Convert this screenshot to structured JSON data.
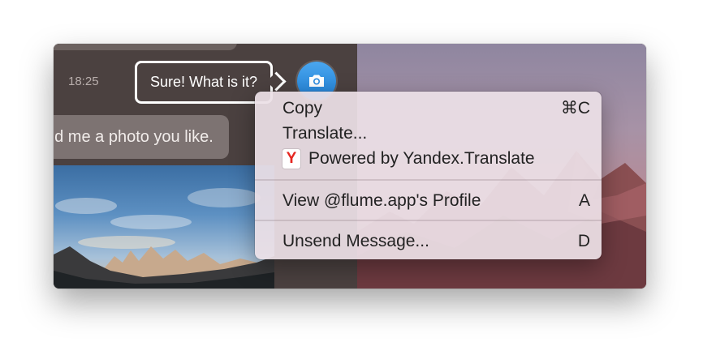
{
  "chat": {
    "timestamp": "18:25",
    "my_message": "Sure! What is it?",
    "their_message": "nd me a photo you like."
  },
  "context_menu": {
    "copy": {
      "label": "Copy",
      "shortcut": "⌘C"
    },
    "translate": {
      "label": "Translate..."
    },
    "powered_by": {
      "label": "Powered by Yandex.Translate",
      "icon_glyph": "Y"
    },
    "view_profile": {
      "label": "View @flume.app's Profile",
      "shortcut": "A"
    },
    "unsend": {
      "label": "Unsend Message...",
      "shortcut": "D"
    }
  },
  "colors": {
    "accent": "#2a8be0",
    "yandex_red": "#e52620"
  }
}
